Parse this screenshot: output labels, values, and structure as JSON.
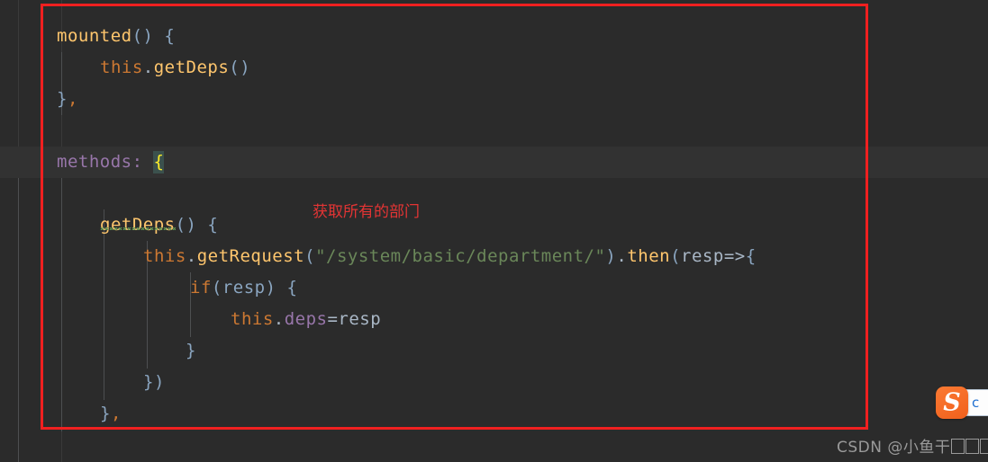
{
  "editor": {
    "theme_background": "#2b2b2b",
    "current_line_background": "#323232",
    "font_size_px": 19,
    "lines": [
      {
        "index": 0,
        "indent_spaces": 0,
        "text": "mounted() {",
        "tokens": [
          {
            "t": "mounted",
            "c": "fn"
          },
          {
            "t": "()",
            "c": "brace"
          },
          {
            "t": " ",
            "c": "punct"
          },
          {
            "t": "{",
            "c": "brace"
          }
        ]
      },
      {
        "index": 1,
        "indent_spaces": 4,
        "text": "    this.getDeps()",
        "tokens": [
          {
            "t": "this",
            "c": "this"
          },
          {
            "t": ".",
            "c": "punct"
          },
          {
            "t": "getDeps",
            "c": "fn"
          },
          {
            "t": "()",
            "c": "brace"
          }
        ]
      },
      {
        "index": 2,
        "indent_spaces": 0,
        "text": "},",
        "tokens": [
          {
            "t": "}",
            "c": "brace"
          },
          {
            "t": ",",
            "c": "this"
          }
        ]
      },
      {
        "index": 3,
        "indent_spaces": 0,
        "text": "",
        "tokens": []
      },
      {
        "index": 4,
        "indent_spaces": 0,
        "text": "methods: {",
        "highlighted": true,
        "tokens": [
          {
            "t": "methods",
            "c": "label"
          },
          {
            "t": ":",
            "c": "prop"
          },
          {
            "t": " ",
            "c": "punct"
          },
          {
            "t": "{",
            "c": "brace-hl"
          }
        ]
      },
      {
        "index": 5,
        "indent_spaces": 0,
        "text": "",
        "tokens": []
      },
      {
        "index": 6,
        "indent_spaces": 4,
        "text": "    getDeps() {",
        "tokens": [
          {
            "t": "getDeps",
            "c": "fn-squiggle"
          },
          {
            "t": "()",
            "c": "brace"
          },
          {
            "t": " ",
            "c": "punct"
          },
          {
            "t": "{",
            "c": "brace"
          }
        ]
      },
      {
        "index": 7,
        "indent_spaces": 8,
        "text": "        this.getRequest(\"/system/basic/department/\").then(resp=>{",
        "tokens": [
          {
            "t": "this",
            "c": "this"
          },
          {
            "t": ".",
            "c": "punct"
          },
          {
            "t": "getRequest",
            "c": "fn"
          },
          {
            "t": "(",
            "c": "brace"
          },
          {
            "t": "\"/system/basic/department/\"",
            "c": "str"
          },
          {
            "t": ")",
            "c": "brace"
          },
          {
            "t": ".",
            "c": "punct"
          },
          {
            "t": "then",
            "c": "fn"
          },
          {
            "t": "(",
            "c": "brace"
          },
          {
            "t": "resp",
            "c": "ident"
          },
          {
            "t": "=>",
            "c": "ident"
          },
          {
            "t": "{",
            "c": "brace"
          }
        ]
      },
      {
        "index": 8,
        "indent_spaces": 12,
        "text": "            if (resp) {",
        "tokens": [
          {
            "t": "if",
            "c": "kw"
          },
          {
            "t": "(resp)",
            "c": "brace"
          },
          {
            "t": " ",
            "c": "punct"
          },
          {
            "t": "{",
            "c": "brace"
          }
        ]
      },
      {
        "index": 9,
        "indent_spaces": 16,
        "text": "                this.deps=resp",
        "tokens": [
          {
            "t": "this",
            "c": "this"
          },
          {
            "t": ".",
            "c": "punct"
          },
          {
            "t": "deps",
            "c": "prop"
          },
          {
            "t": "=resp",
            "c": "ident"
          }
        ]
      },
      {
        "index": 10,
        "indent_spaces": 12,
        "text": "            }",
        "tokens": [
          {
            "t": "}",
            "c": "brace"
          }
        ]
      },
      {
        "index": 11,
        "indent_spaces": 8,
        "text": "        })",
        "tokens": [
          {
            "t": "})",
            "c": "brace"
          }
        ]
      },
      {
        "index": 12,
        "indent_spaces": 4,
        "text": "    },",
        "tokens": [
          {
            "t": "}",
            "c": "brace"
          },
          {
            "t": ",",
            "c": "this"
          }
        ]
      }
    ]
  },
  "annotations": {
    "rectangle": {
      "color": "#f02020",
      "label": "code-highlight-box"
    },
    "comment": {
      "text": "获取所有的部门",
      "color": "#e33434"
    }
  },
  "watermark": {
    "prefix": "CSDN @",
    "author": "小鱼干",
    "unrendered_glyph_count": 3,
    "color": "#9a9a9a"
  },
  "ime": {
    "logo_letter": "S",
    "logo_color": "#f1601c",
    "bar_text": "c"
  }
}
